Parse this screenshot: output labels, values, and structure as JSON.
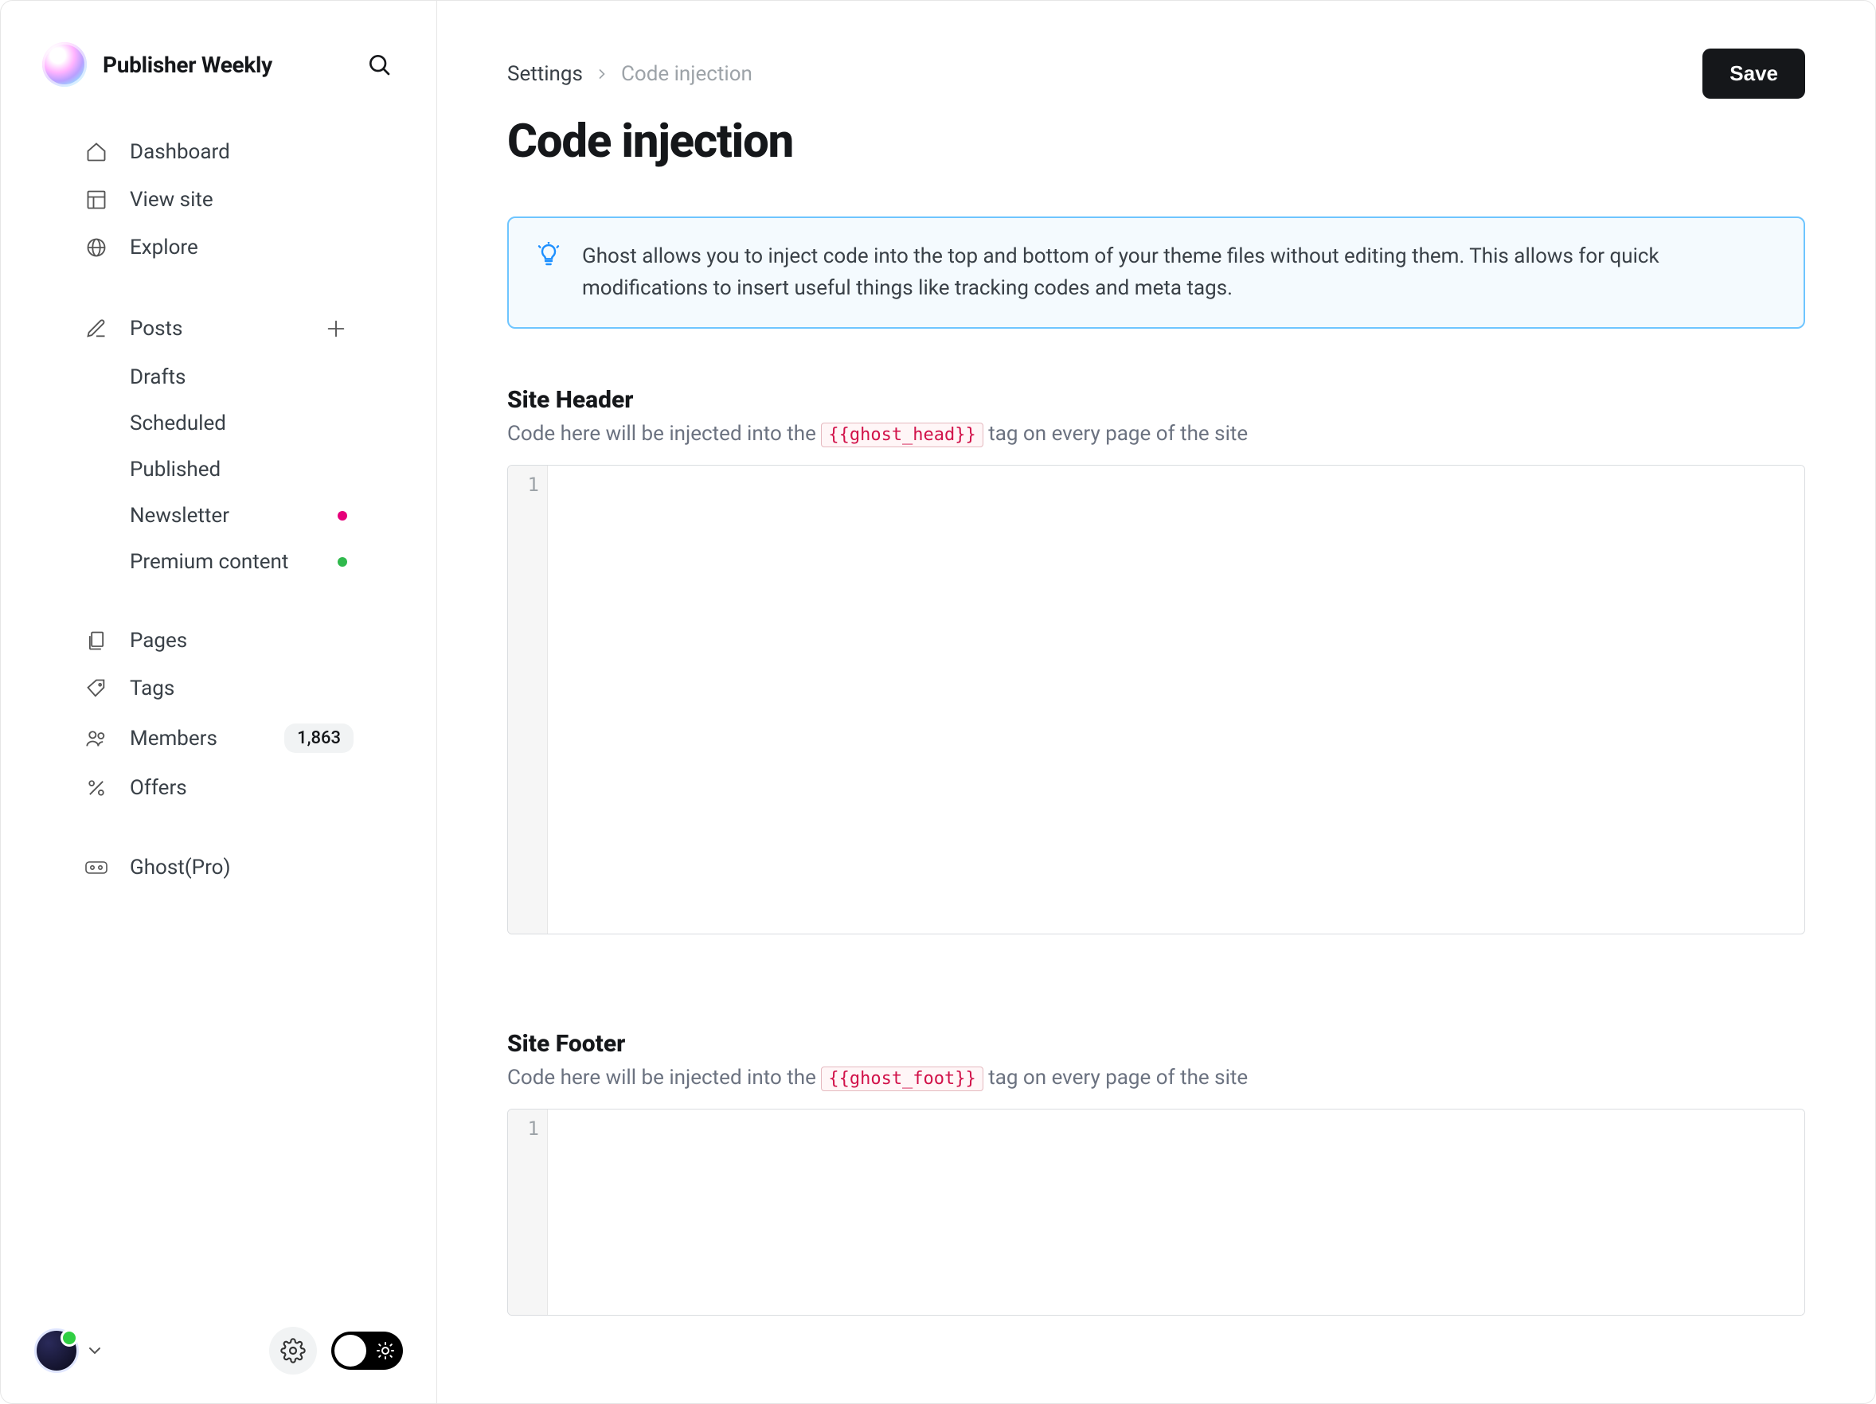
{
  "site": {
    "name": "Publisher Weekly"
  },
  "sidebar": {
    "main": [
      {
        "label": "Dashboard"
      },
      {
        "label": "View site"
      },
      {
        "label": "Explore"
      }
    ],
    "posts": {
      "label": "Posts",
      "sub": [
        {
          "label": "Drafts"
        },
        {
          "label": "Scheduled"
        },
        {
          "label": "Published"
        },
        {
          "label": "Newsletter"
        },
        {
          "label": "Premium content"
        }
      ]
    },
    "secondary": [
      {
        "label": "Pages"
      },
      {
        "label": "Tags"
      },
      {
        "label": "Members",
        "badge": "1,863"
      },
      {
        "label": "Offers"
      }
    ],
    "ghostpro": {
      "label": "Ghost(Pro)"
    }
  },
  "breadcrumb": {
    "parent": "Settings",
    "current": "Code injection"
  },
  "page": {
    "title": "Code injection",
    "save_label": "Save",
    "info": "Ghost allows you to inject code into the top and bottom of your theme files without editing them. This allows for quick modifications to insert useful things like tracking codes and meta tags."
  },
  "header_section": {
    "title": "Site Header",
    "desc_prefix": "Code here will be injected into the ",
    "tag": "{{ghost_head}}",
    "desc_suffix": " tag on every page of the site",
    "line_number": "1",
    "value": ""
  },
  "footer_section": {
    "title": "Site Footer",
    "desc_prefix": "Code here will be injected into the ",
    "tag": "{{ghost_foot}}",
    "desc_suffix": " tag on every page of the site",
    "line_number": "1",
    "value": ""
  }
}
